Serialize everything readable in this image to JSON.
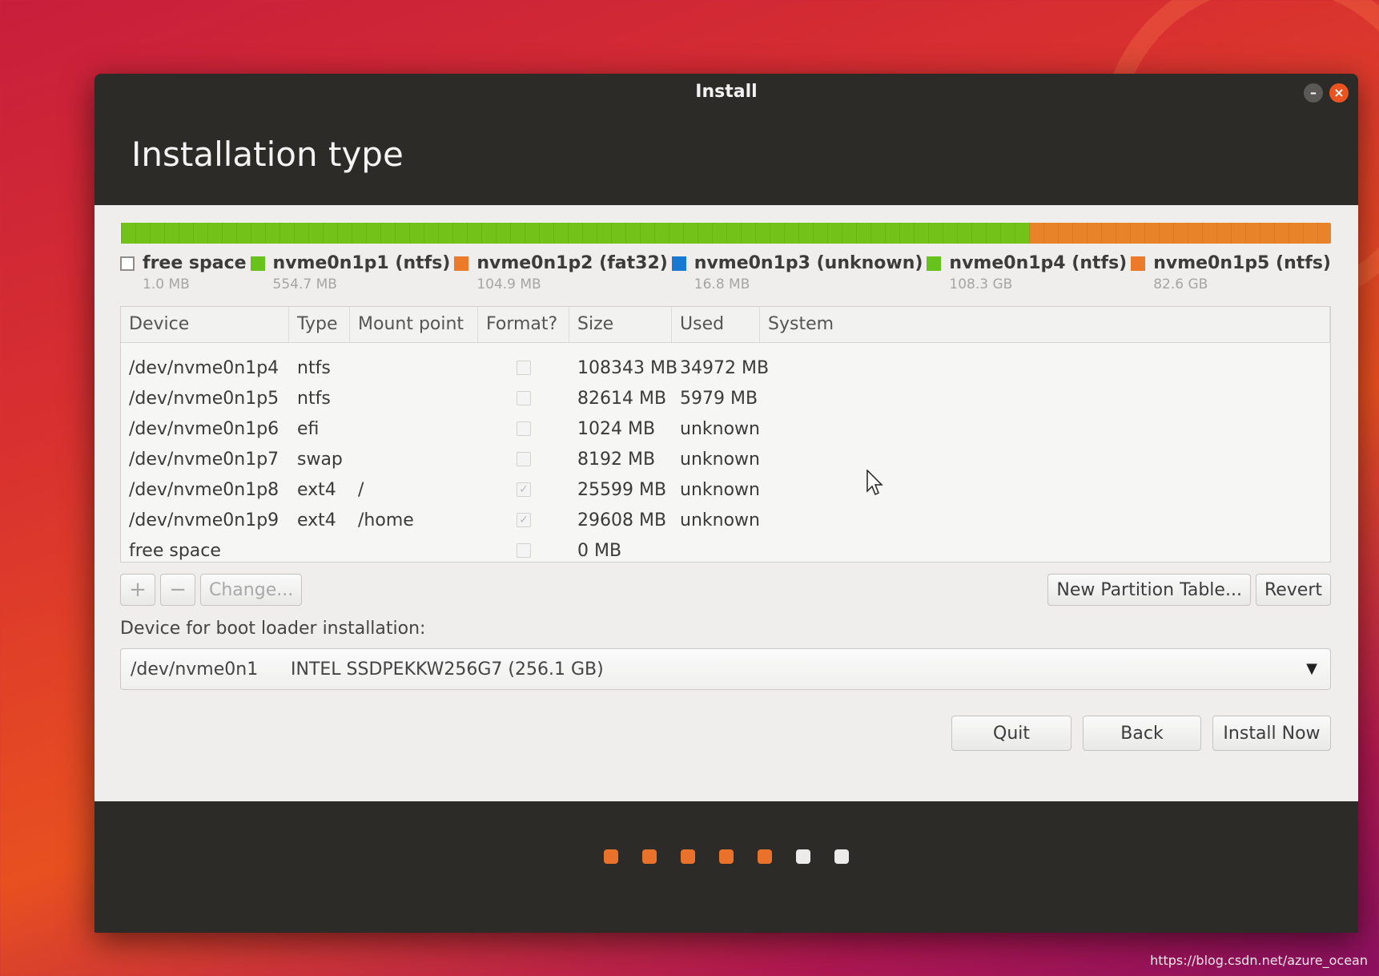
{
  "window": {
    "title": "Install",
    "heading": "Installation type"
  },
  "legend": [
    {
      "name": "free space",
      "size": "1.0 MB",
      "color": "#ffffff"
    },
    {
      "name": "nvme0n1p1 (ntfs)",
      "size": "554.7 MB",
      "color": "#67c31b"
    },
    {
      "name": "nvme0n1p2 (fat32)",
      "size": "104.9 MB",
      "color": "#ec7a2b"
    },
    {
      "name": "nvme0n1p3 (unknown)",
      "size": "16.8 MB",
      "color": "#1979d2"
    },
    {
      "name": "nvme0n1p4 (ntfs)",
      "size": "108.3 GB",
      "color": "#67c31b"
    },
    {
      "name": "nvme0n1p5 (ntfs)",
      "size": "82.6 GB",
      "color": "#ec7a2b"
    }
  ],
  "table": {
    "headers": [
      "Device",
      "Type",
      "Mount point",
      "Format?",
      "Size",
      "Used",
      "System"
    ],
    "rows": [
      {
        "device": "/dev/nvme0n1p4",
        "type": "ntfs",
        "mount": "",
        "format": false,
        "size": "108343 MB",
        "used": "34972 MB"
      },
      {
        "device": "/dev/nvme0n1p5",
        "type": "ntfs",
        "mount": "",
        "format": false,
        "size": "82614 MB",
        "used": "5979 MB"
      },
      {
        "device": "/dev/nvme0n1p6",
        "type": "efi",
        "mount": "",
        "format": false,
        "size": "1024 MB",
        "used": "unknown"
      },
      {
        "device": "/dev/nvme0n1p7",
        "type": "swap",
        "mount": "",
        "format": false,
        "size": "8192 MB",
        "used": "unknown"
      },
      {
        "device": "/dev/nvme0n1p8",
        "type": "ext4",
        "mount": "/",
        "format": true,
        "size": "25599 MB",
        "used": "unknown"
      },
      {
        "device": "/dev/nvme0n1p9",
        "type": "ext4",
        "mount": "/home",
        "format": true,
        "size": "29608 MB",
        "used": "unknown"
      },
      {
        "device": "free space",
        "type": "",
        "mount": "",
        "format": false,
        "size": "0 MB",
        "used": ""
      }
    ]
  },
  "toolbar": {
    "add": "+",
    "remove": "−",
    "change": "Change...",
    "new_table": "New Partition Table...",
    "revert": "Revert"
  },
  "boot": {
    "label": "Device for boot loader installation:",
    "device": "/dev/nvme0n1",
    "desc": "INTEL SSDPEKKW256G7 (256.1 GB)"
  },
  "actions": {
    "quit": "Quit",
    "back": "Back",
    "install": "Install Now"
  },
  "progress": {
    "steps_total": 7,
    "steps_done": 5
  },
  "watermark": "https://blog.csdn.net/azure_ocean"
}
